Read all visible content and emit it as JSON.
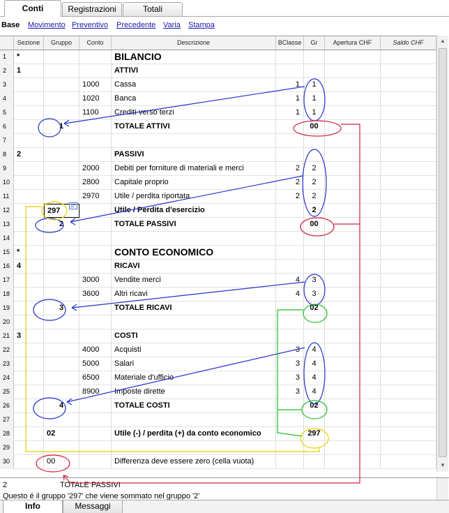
{
  "top_tabs": [
    "Conti",
    "Registrazioni",
    "Totali"
  ],
  "viewbar": {
    "base": "Base",
    "links": [
      "Movimento",
      "Preventivo",
      "Precedente",
      "Varia",
      "Stampa"
    ]
  },
  "columns": [
    "Sezione",
    "Gruppo",
    "Conto",
    "Descrizione",
    "BClasse",
    "Gr",
    "Apertura CHF",
    "Saldo CHF"
  ],
  "rows": [
    {
      "n": "1",
      "sezione": "*",
      "gruppo": "",
      "conto": "",
      "desc": "BILANCIO",
      "bclasse": "",
      "gr": "",
      "style": "title"
    },
    {
      "n": "2",
      "sezione": "1",
      "gruppo": "",
      "conto": "",
      "desc": "ATTIVI",
      "bclasse": "",
      "gr": "",
      "style": "bold"
    },
    {
      "n": "3",
      "sezione": "",
      "gruppo": "",
      "conto": "1000",
      "desc": "Cassa",
      "bclasse": "1",
      "gr": "1",
      "style": ""
    },
    {
      "n": "4",
      "sezione": "",
      "gruppo": "",
      "conto": "1020",
      "desc": "Banca",
      "bclasse": "1",
      "gr": "1",
      "style": ""
    },
    {
      "n": "5",
      "sezione": "",
      "gruppo": "",
      "conto": "1100",
      "desc": "Crediti verso terzi",
      "bclasse": "1",
      "gr": "1",
      "style": ""
    },
    {
      "n": "6",
      "sezione": "",
      "gruppo": "1",
      "conto": "",
      "desc": "TOTALE ATTIVI",
      "bclasse": "",
      "gr": "00",
      "style": "bold"
    },
    {
      "n": "7",
      "sezione": "",
      "gruppo": "",
      "conto": "",
      "desc": "",
      "bclasse": "",
      "gr": "",
      "style": ""
    },
    {
      "n": "8",
      "sezione": "2",
      "gruppo": "",
      "conto": "",
      "desc": "PASSIVI",
      "bclasse": "",
      "gr": "",
      "style": "bold"
    },
    {
      "n": "9",
      "sezione": "",
      "gruppo": "",
      "conto": "2000",
      "desc": "Debiti per forniture di materiali e merci",
      "bclasse": "2",
      "gr": "2",
      "style": ""
    },
    {
      "n": "10",
      "sezione": "",
      "gruppo": "",
      "conto": "2800",
      "desc": "Capitale proprio",
      "bclasse": "2",
      "gr": "2",
      "style": ""
    },
    {
      "n": "11",
      "sezione": "",
      "gruppo": "",
      "conto": "2970",
      "desc": "Utile / perdita riportata",
      "bclasse": "2",
      "gr": "2",
      "style": ""
    },
    {
      "n": "12",
      "sezione": "",
      "gruppo": "297",
      "conto": "",
      "desc": "Utile / Perdita d'esercizio",
      "bclasse": "",
      "gr": "2",
      "style": "bold"
    },
    {
      "n": "13",
      "sezione": "",
      "gruppo": "2",
      "conto": "",
      "desc": "TOTALE PASSIVI",
      "bclasse": "",
      "gr": "00",
      "style": "bold"
    },
    {
      "n": "14",
      "sezione": "",
      "gruppo": "",
      "conto": "",
      "desc": "",
      "bclasse": "",
      "gr": "",
      "style": ""
    },
    {
      "n": "15",
      "sezione": "*",
      "gruppo": "",
      "conto": "",
      "desc": "CONTO ECONOMICO",
      "bclasse": "",
      "gr": "",
      "style": "title"
    },
    {
      "n": "16",
      "sezione": "4",
      "gruppo": "",
      "conto": "",
      "desc": "RICAVI",
      "bclasse": "",
      "gr": "",
      "style": "bold"
    },
    {
      "n": "17",
      "sezione": "",
      "gruppo": "",
      "conto": "3000",
      "desc": "Vendite merci",
      "bclasse": "4",
      "gr": "3",
      "style": ""
    },
    {
      "n": "18",
      "sezione": "",
      "gruppo": "",
      "conto": "3600",
      "desc": "Altri ricavi",
      "bclasse": "4",
      "gr": "3",
      "style": ""
    },
    {
      "n": "19",
      "sezione": "",
      "gruppo": "3",
      "conto": "",
      "desc": "TOTALE RICAVI",
      "bclasse": "",
      "gr": "02",
      "style": "bold"
    },
    {
      "n": "20",
      "sezione": "",
      "gruppo": "",
      "conto": "",
      "desc": "",
      "bclasse": "",
      "gr": "",
      "style": ""
    },
    {
      "n": "21",
      "sezione": "3",
      "gruppo": "",
      "conto": "",
      "desc": "COSTI",
      "bclasse": "",
      "gr": "",
      "style": "bold"
    },
    {
      "n": "22",
      "sezione": "",
      "gruppo": "",
      "conto": "4000",
      "desc": "Acquisti",
      "bclasse": "3",
      "gr": "4",
      "style": ""
    },
    {
      "n": "23",
      "sezione": "",
      "gruppo": "",
      "conto": "5000",
      "desc": "Salari",
      "bclasse": "3",
      "gr": "4",
      "style": ""
    },
    {
      "n": "24",
      "sezione": "",
      "gruppo": "",
      "conto": "6500",
      "desc": "Materiale d'ufficio",
      "bclasse": "3",
      "gr": "4",
      "style": ""
    },
    {
      "n": "25",
      "sezione": "",
      "gruppo": "",
      "conto": "8900",
      "desc": "Imposte dirette",
      "bclasse": "3",
      "gr": "4",
      "style": ""
    },
    {
      "n": "26",
      "sezione": "",
      "gruppo": "4",
      "conto": "",
      "desc": "TOTALE COSTI",
      "bclasse": "",
      "gr": "02",
      "style": "bold"
    },
    {
      "n": "27",
      "sezione": "",
      "gruppo": "",
      "conto": "",
      "desc": "",
      "bclasse": "",
      "gr": "",
      "style": ""
    },
    {
      "n": "28",
      "sezione": "",
      "gruppo": "02",
      "conto": "",
      "desc": "Utile (-) / perdita (+) da conto economico",
      "bclasse": "",
      "gr": "297",
      "style": "bold"
    },
    {
      "n": "29",
      "sezione": "",
      "gruppo": "",
      "conto": "",
      "desc": "",
      "bclasse": "",
      "gr": "",
      "style": ""
    },
    {
      "n": "30",
      "sezione": "",
      "gruppo": "00",
      "conto": "",
      "desc": "Differenza deve essere zero (cella vuota)",
      "bclasse": "",
      "gr": "",
      "style": ""
    }
  ],
  "info": {
    "code": "2",
    "title": "TOTALE PASSIVI",
    "text": "Questo é il gruppo '297' che viene sommato nel gruppo '2'"
  },
  "bottom_tabs": [
    "Info",
    "Messaggi"
  ],
  "colors": {
    "blue": "#2233cc",
    "red": "#d0203a",
    "green": "#22bb22",
    "yellow": "#e8d820"
  }
}
